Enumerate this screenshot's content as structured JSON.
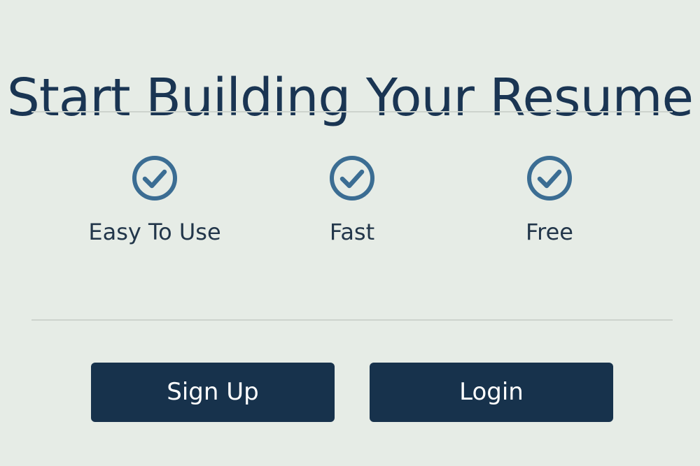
{
  "page": {
    "title": "Start Building Your Resume"
  },
  "features": [
    {
      "icon": "check-circle-icon",
      "label": "Easy To Use"
    },
    {
      "icon": "check-circle-icon",
      "label": "Fast"
    },
    {
      "icon": "check-circle-icon",
      "label": "Free"
    }
  ],
  "actions": {
    "signup_label": "Sign Up",
    "login_label": "Login"
  },
  "colors": {
    "background": "#e6ece6",
    "title_text": "#1a3553",
    "icon_accent": "#3b6d93",
    "button_bg": "#17324c",
    "button_text": "#ffffff",
    "divider": "#cdd3cd"
  }
}
